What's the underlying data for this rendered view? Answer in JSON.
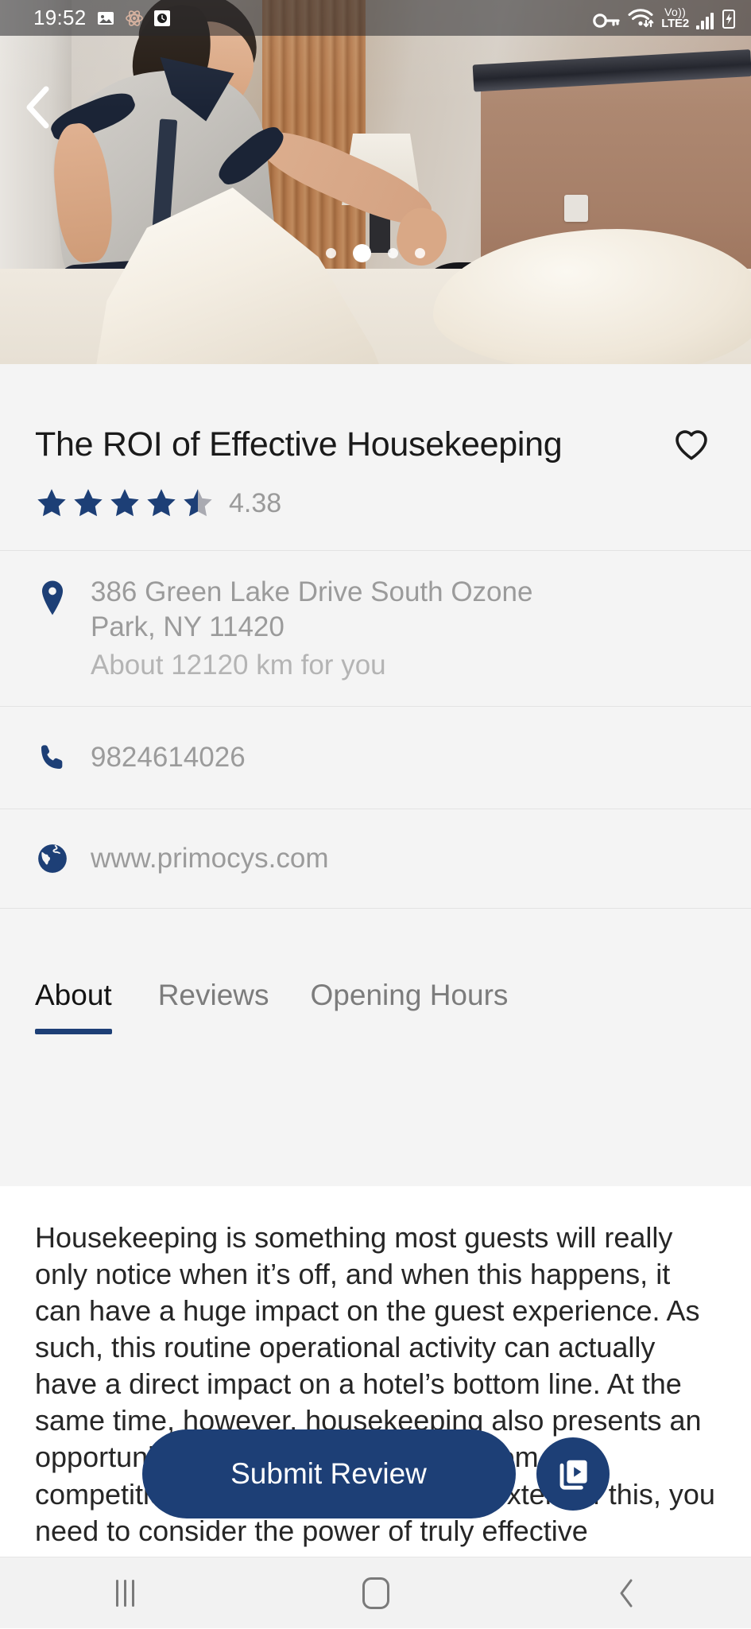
{
  "status_bar": {
    "time": "19:52",
    "left_icons": [
      "image-icon",
      "atom-icon",
      "clock-icon"
    ],
    "right_icons": [
      "vpn-key-icon",
      "wifi-icon",
      "signal-bars-icon",
      "battery-charging-icon"
    ],
    "network_line1": "Vo))",
    "network_line2": "LTE2"
  },
  "hero": {
    "back_icon": "back-chevron-icon",
    "dots_count": 4,
    "active_dot_index": 1,
    "alt": "Housekeeper fluffing a white pillow on a hotel bed"
  },
  "listing": {
    "title": "The ROI of Effective Housekeeping",
    "favorite_icon": "heart-outline-icon",
    "rating_value": "4.38",
    "stars_filled": 4,
    "stars_half": 1,
    "stars_total": 5,
    "address_line1": "386 Green Lake Drive South Ozone",
    "address_line2": "Park, NY 11420",
    "distance": "About 12120 km for you",
    "phone": "9824614026",
    "website": "www.primocys.com",
    "location_icon": "map-pin-icon",
    "phone_icon": "phone-icon",
    "web_icon": "globe-icon"
  },
  "tabs": [
    {
      "label": "About",
      "active": true
    },
    {
      "label": "Reviews",
      "active": false
    },
    {
      "label": "Opening Hours",
      "active": false
    }
  ],
  "about": {
    "text": "Housekeeping is something most guests will really only notice when it’s off, and when this happens, it can have a huge impact on the guest experience. As such, this routine operational activity can actually have a direct impact on a hotel’s bottom line. At the same time, however, housekeeping also presents an opportunity to differentiate yourself from the competition. To understand the true extent of this, you need to consider the power of truly effective housekeeping operations."
  },
  "actions": {
    "submit_label": "Submit Review",
    "fab_icon": "media-play-card-icon"
  },
  "navbar": {
    "recents_label": "recents-icon",
    "home_label": "home-icon",
    "back_label": "back-icon"
  },
  "colors": {
    "brand": "#1d3f76",
    "star": "#1d3f76",
    "muted_text": "#9b9b9b",
    "sheet_bg": "#f4f4f4"
  }
}
